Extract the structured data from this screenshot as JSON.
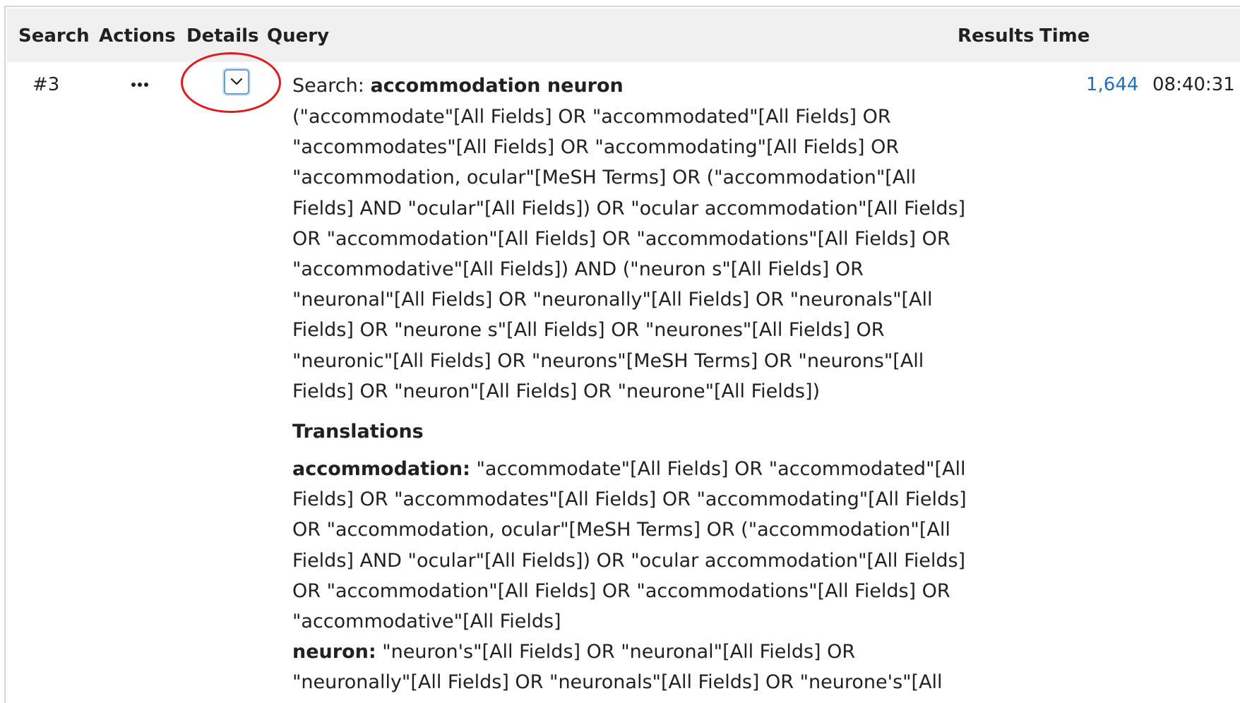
{
  "table": {
    "headers": {
      "search": "Search",
      "actions": "Actions",
      "details": "Details",
      "query": "Query",
      "results": "Results",
      "time": "Time"
    },
    "row": {
      "number": "#3",
      "actions_icon": "more-horizontal-icon",
      "details_icon": "chevron-down-icon",
      "search_label": "Search:",
      "search_term": "accommodation neuron",
      "query_text": "(\"accommodate\"[All Fields] OR \"accommodated\"[All Fields] OR \"accommodates\"[All Fields] OR \"accommodating\"[All Fields] OR \"accommodation, ocular\"[MeSH Terms] OR (\"accommodation\"[All Fields] AND \"ocular\"[All Fields]) OR \"ocular accommodation\"[All Fields] OR \"accommodation\"[All Fields] OR \"accommodations\"[All Fields] OR \"accommodative\"[All Fields]) AND (\"neuron s\"[All Fields] OR \"neuronal\"[All Fields] OR \"neuronally\"[All Fields] OR \"neuronals\"[All Fields] OR \"neurone s\"[All Fields] OR \"neurones\"[All Fields] OR \"neuronic\"[All Fields] OR \"neurons\"[MeSH Terms] OR \"neurons\"[All Fields] OR \"neuron\"[All Fields] OR \"neurone\"[All Fields])",
      "translations_heading": "Translations",
      "translations": [
        {
          "term": "accommodation:",
          "text": "\"accommodate\"[All Fields] OR \"accommodated\"[All Fields] OR \"accommodates\"[All Fields] OR \"accommodating\"[All Fields] OR \"accommodation, ocular\"[MeSH Terms] OR (\"accommodation\"[All Fields] AND \"ocular\"[All Fields]) OR \"ocular accommodation\"[All Fields] OR \"accommodation\"[All Fields] OR \"accommodations\"[All Fields] OR \"accommodative\"[All Fields]"
        },
        {
          "term": "neuron:",
          "text": "\"neuron's\"[All Fields] OR \"neuronal\"[All Fields] OR \"neuronally\"[All Fields] OR \"neuronals\"[All Fields] OR \"neurone's\"[All"
        }
      ],
      "results": "1,644",
      "time": "08:40:31"
    }
  },
  "colors": {
    "header_bg": "#f0f0f0",
    "link": "#1f6fbf",
    "highlight_ring": "#e01b1b",
    "focus_border": "#6b9fd0"
  }
}
